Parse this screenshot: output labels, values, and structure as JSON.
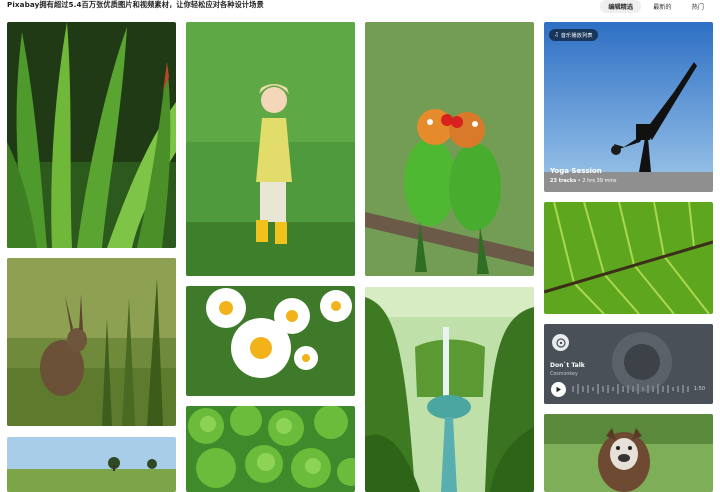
{
  "header": {
    "headline": "Pixabay拥有超过5.4百万张优质图片和视频素材，让你轻松应对各种设计场景",
    "tabs": [
      {
        "label": "编辑精选",
        "active": true
      },
      {
        "label": "最新的",
        "active": false
      },
      {
        "label": "热门",
        "active": false
      }
    ]
  },
  "gallery": {
    "yoga_card": {
      "badge": "音乐播放列表",
      "title": "Yoga Session",
      "tracks": "23 tracks",
      "duration": "• 2 hrs 39 mins"
    },
    "music_card": {
      "title": "Don`t Talk",
      "artist": "Cosmonkey",
      "time": "1:50"
    },
    "tiles": [
      {
        "subject": "aloe plant",
        "icon": "image"
      },
      {
        "subject": "girl in grass",
        "icon": "image"
      },
      {
        "subject": "lovebirds",
        "icon": "image"
      },
      {
        "subject": "leaf veins",
        "icon": "image"
      },
      {
        "subject": "hare",
        "icon": "image"
      },
      {
        "subject": "daisies",
        "icon": "image"
      },
      {
        "subject": "waterfall valley",
        "icon": "image"
      },
      {
        "subject": "landscape trees",
        "icon": "image"
      },
      {
        "subject": "green leaves",
        "icon": "image"
      },
      {
        "subject": "bulldog",
        "icon": "image"
      }
    ]
  },
  "colors": {
    "active_tab_bg": "#efefef",
    "music_card_bg": "#4a5058"
  }
}
